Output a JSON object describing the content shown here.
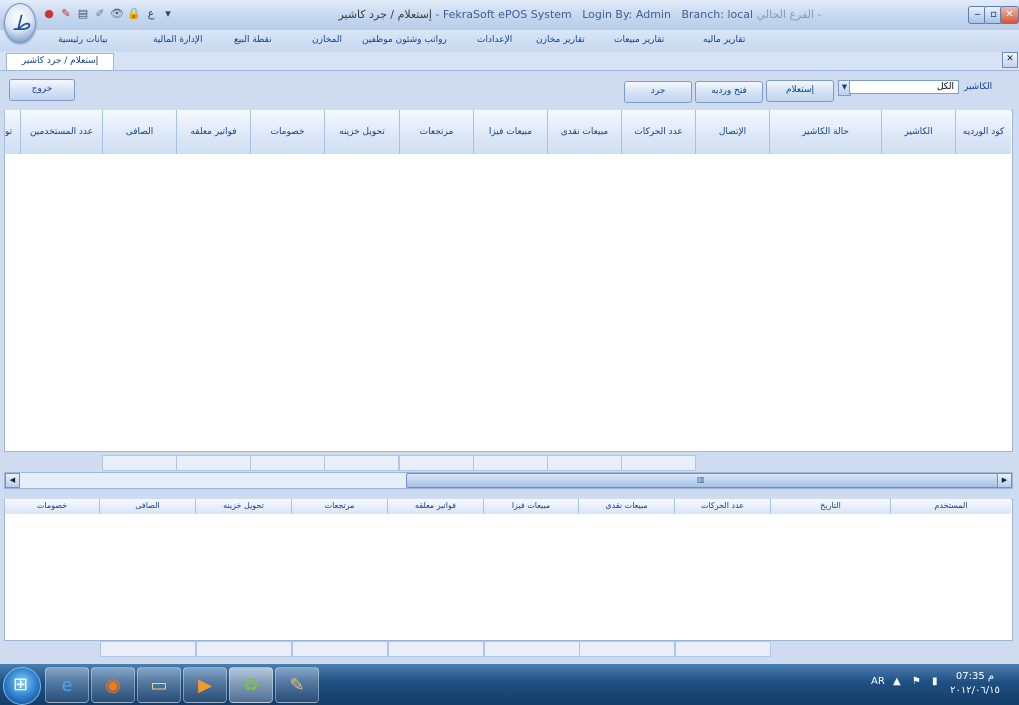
{
  "window": {
    "title_ar_right": "الفرع الحالي - ",
    "title_branch": "Branch: local",
    "title_login": "Login By: Admin",
    "title_app": "FekraSoft ePOS System",
    "title_screen": "إستعلام / جرد  كاشير",
    "minimize": "‒",
    "maximize": "▫",
    "close": "✕"
  },
  "orb": {
    "glyph": "ط"
  },
  "quick_access": [
    "●",
    "✎",
    "▤",
    "✐",
    "👁",
    "🔒",
    "ع",
    "▾"
  ],
  "menu": {
    "items": [
      "بيانات رئيسية",
      "نقطة البيع",
      "الإدارة المالية",
      "المخازن",
      "رواتب وشئون موظفين",
      "الإعدادات",
      "تقارير مخازن",
      "تقارير مبيعات",
      "تقارير ماليه"
    ]
  },
  "tab": {
    "label": "إستعلام / جرد  كاشير",
    "close": "✕"
  },
  "toolbar": {
    "cashier_label": "الكاشير",
    "cashier_value": "الكل",
    "combo_arrow": "▼",
    "query": "إستعلام",
    "open_shift": "فتح ورديه",
    "inventory": "جرد",
    "exit": "خروج"
  },
  "grid_main": {
    "columns": [
      "كود الورديه",
      "الكاشير",
      "حالة الكاشير",
      "الإتصال",
      "عدد الحركات",
      "مبيعات نقدى",
      "مبيعات فيزا",
      "مرتجعات",
      "تحويل خزينه",
      "خصومات",
      "فواتير معلقه",
      "الصافى",
      "عدد المستخدمين",
      "تو"
    ]
  },
  "grid_detail": {
    "columns": [
      "المستخدم",
      "التاريخ",
      "عدد الحركات",
      "مبيعات نقدى",
      "مبيعات فيزا",
      "فواتير معلقه",
      "مرتجعات",
      "تحويل خزينه",
      "الصافى",
      "خصومات"
    ]
  },
  "scrollbar": {
    "left": "◀",
    "right": "▶",
    "grip": "▥"
  },
  "taskbar": {
    "start": "⊞",
    "apps": [
      "e",
      "◉",
      "▭",
      "▶",
      "♻",
      "✎"
    ],
    "lang": "AR",
    "tray": "▲ ⚑ ▮",
    "time": "07:35 م",
    "date": "٢٠١٢/٠٦/١٥"
  }
}
